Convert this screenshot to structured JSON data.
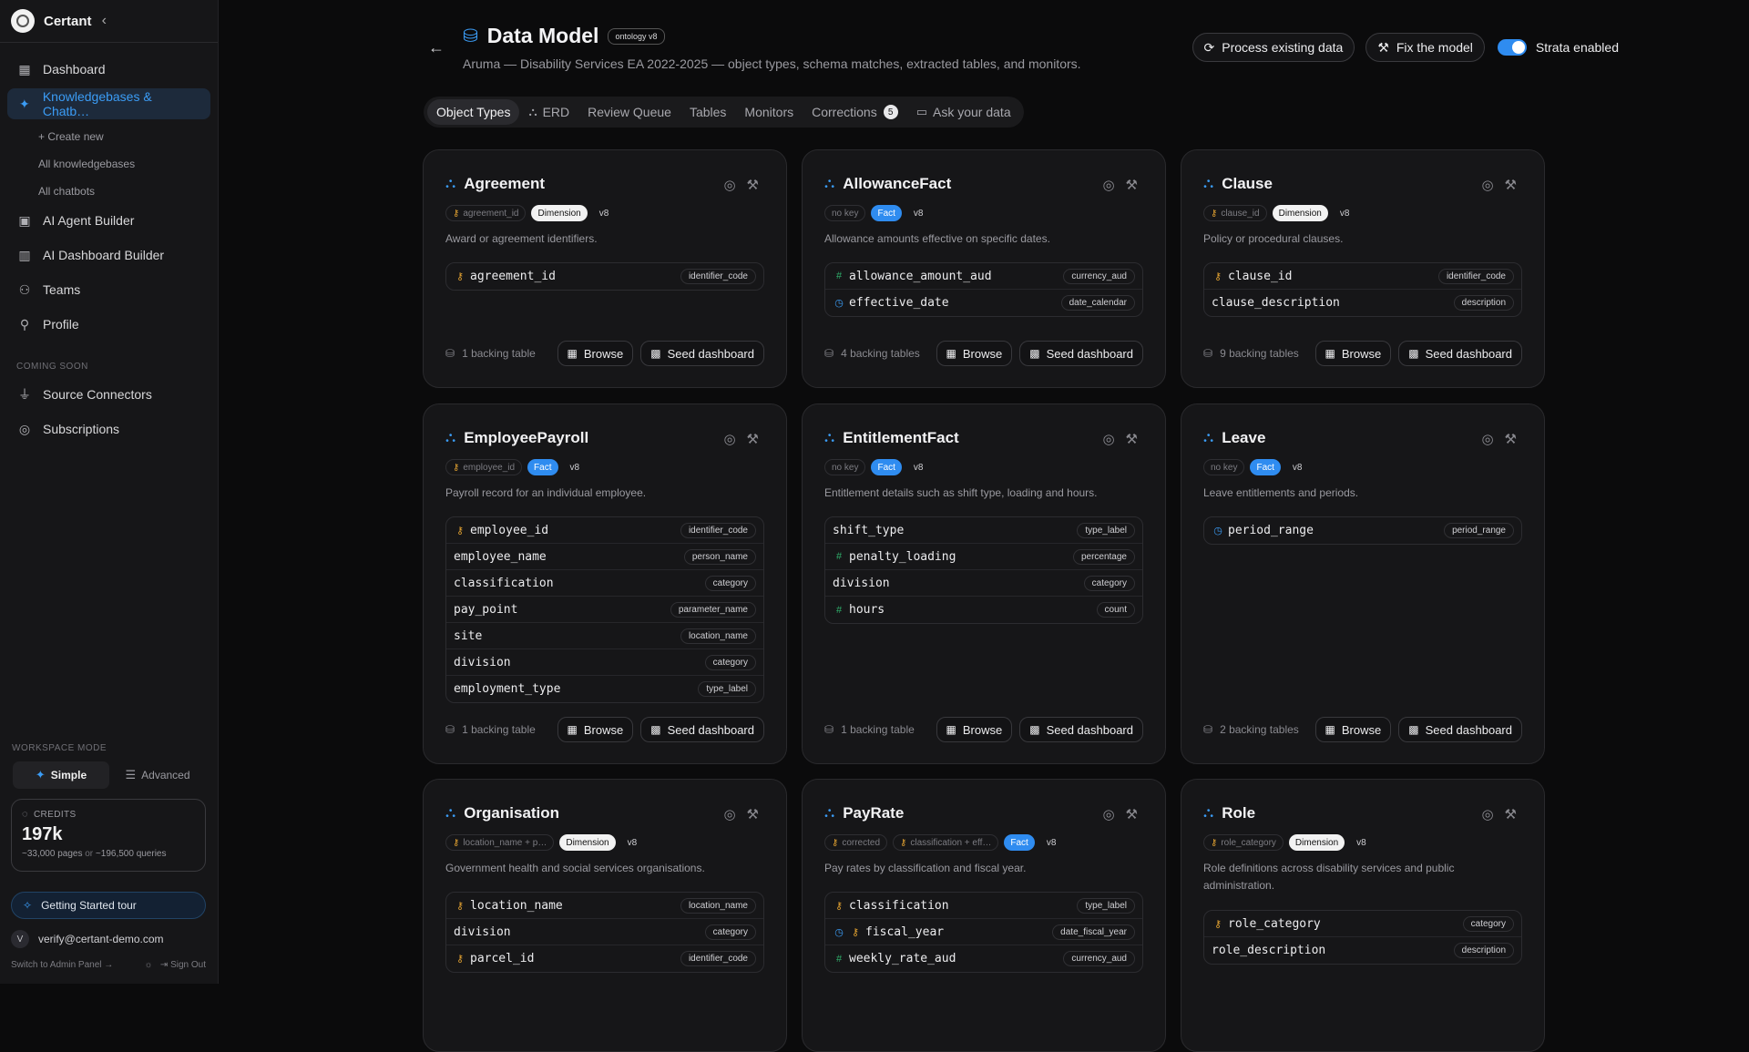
{
  "sidebar": {
    "brand": "Certant",
    "nav": [
      {
        "label": "Dashboard",
        "icon": "grid-icon"
      },
      {
        "label": "Knowledgebases & Chatb…",
        "icon": "sparkle-icon"
      }
    ],
    "subnav": [
      "+ Create new",
      "All knowledgebases",
      "All chatbots"
    ],
    "nav2": [
      {
        "label": "AI Agent Builder",
        "icon": "robot-icon"
      },
      {
        "label": "AI Dashboard Builder",
        "icon": "bar-chart-icon"
      },
      {
        "label": "Teams",
        "icon": "users-icon"
      },
      {
        "label": "Profile",
        "icon": "user-icon"
      }
    ],
    "coming_soon_label": "COMING SOON",
    "coming": [
      {
        "label": "Source Connectors",
        "icon": "plug-icon"
      },
      {
        "label": "Subscriptions",
        "icon": "broadcast-icon"
      }
    ],
    "workspace_mode_label": "WORKSPACE MODE",
    "mode_simple": "Simple",
    "mode_advanced": "Advanced",
    "credits_label": "CREDITS",
    "credits_value": "197k",
    "credits_sub_a": "~33,000 pages",
    "credits_sub_or": "or",
    "credits_sub_b": "~196,500 queries",
    "tour": "Getting Started tour",
    "user_initial": "V",
    "user_email": "verify@certant-demo.com",
    "admin_link": "Switch to Admin Panel →",
    "sign_out": "Sign Out"
  },
  "header": {
    "title": "Data Model",
    "badge": "ontology v8",
    "subtitle": "Aruma — Disability Services EA 2022-2025 — object types, schema matches, extracted tables, and monitors.",
    "process_btn": "Process existing data",
    "fix_btn": "Fix the model",
    "strata_label": "Strata enabled"
  },
  "tabs": [
    {
      "label": "Object Types",
      "active": true
    },
    {
      "label": "ERD",
      "icon": "⛬"
    },
    {
      "label": "Review Queue"
    },
    {
      "label": "Tables"
    },
    {
      "label": "Monitors"
    },
    {
      "label": "Corrections",
      "count": "5"
    },
    {
      "label": "Ask your data",
      "icon": "▭"
    }
  ],
  "cards": [
    {
      "name": "Agreement",
      "key": "agreement_id",
      "kind": "Dimension",
      "version": "v8",
      "desc": "Award or agreement identifiers.",
      "fields": [
        {
          "name": "agreement_id",
          "type": "identifier_code",
          "icon": "key"
        }
      ],
      "backing": "1 backing table"
    },
    {
      "name": "AllowanceFact",
      "key": "no key",
      "kind": "Fact",
      "version": "v8",
      "desc": "Allowance amounts effective on specific dates.",
      "fields": [
        {
          "name": "allowance_amount_aud",
          "type": "currency_aud",
          "icon": "num"
        },
        {
          "name": "effective_date",
          "type": "date_calendar",
          "icon": "time"
        }
      ],
      "backing": "4 backing tables"
    },
    {
      "name": "Clause",
      "key": "clause_id",
      "kind": "Dimension",
      "version": "v8",
      "desc": "Policy or procedural clauses.",
      "fields": [
        {
          "name": "clause_id",
          "type": "identifier_code",
          "icon": "key"
        },
        {
          "name": "clause_description",
          "type": "description",
          "icon": ""
        }
      ],
      "backing": "9 backing tables"
    },
    {
      "name": "EmployeePayroll",
      "key": "employee_id",
      "kind": "Fact",
      "version": "v8",
      "desc": "Payroll record for an individual employee.",
      "fields": [
        {
          "name": "employee_id",
          "type": "identifier_code",
          "icon": "key"
        },
        {
          "name": "employee_name",
          "type": "person_name",
          "icon": ""
        },
        {
          "name": "classification",
          "type": "category",
          "icon": ""
        },
        {
          "name": "pay_point",
          "type": "parameter_name",
          "icon": ""
        },
        {
          "name": "site",
          "type": "location_name",
          "icon": ""
        },
        {
          "name": "division",
          "type": "category",
          "icon": ""
        },
        {
          "name": "employment_type",
          "type": "type_label",
          "icon": ""
        }
      ],
      "backing": "1 backing table"
    },
    {
      "name": "EntitlementFact",
      "key": "no key",
      "kind": "Fact",
      "version": "v8",
      "desc": "Entitlement details such as shift type, loading and hours.",
      "fields": [
        {
          "name": "shift_type",
          "type": "type_label",
          "icon": ""
        },
        {
          "name": "penalty_loading",
          "type": "percentage",
          "icon": "num"
        },
        {
          "name": "division",
          "type": "category",
          "icon": ""
        },
        {
          "name": "hours",
          "type": "count",
          "icon": "num"
        }
      ],
      "backing": "1 backing table"
    },
    {
      "name": "Leave",
      "key": "no key",
      "kind": "Fact",
      "version": "v8",
      "desc": "Leave entitlements and periods.",
      "fields": [
        {
          "name": "period_range",
          "type": "period_range",
          "icon": "time"
        }
      ],
      "backing": "2 backing tables"
    },
    {
      "name": "Organisation",
      "key": "location_name + p…",
      "kind": "Dimension",
      "version": "v8",
      "desc": "Government health and social services organisations.",
      "fields": [
        {
          "name": "location_name",
          "type": "location_name",
          "icon": "key"
        },
        {
          "name": "division",
          "type": "category",
          "icon": ""
        },
        {
          "name": "parcel_id",
          "type": "identifier_code",
          "icon": "key"
        }
      ],
      "backing": ""
    },
    {
      "name": "PayRate",
      "key": "corrected",
      "key2": "classification + eff…",
      "kind": "Fact",
      "version": "v8",
      "desc": "Pay rates by classification and fiscal year.",
      "fields": [
        {
          "name": "classification",
          "type": "type_label",
          "icon": "key"
        },
        {
          "name": "fiscal_year",
          "type": "date_fiscal_year",
          "icon": "timekey"
        },
        {
          "name": "weekly_rate_aud",
          "type": "currency_aud",
          "icon": "num"
        }
      ],
      "backing": ""
    },
    {
      "name": "Role",
      "key": "role_category",
      "kind": "Dimension",
      "version": "v8",
      "desc": "Role definitions across disability services and public administration.",
      "fields": [
        {
          "name": "role_category",
          "type": "category",
          "icon": "key"
        },
        {
          "name": "role_description",
          "type": "description",
          "icon": ""
        }
      ],
      "backing": ""
    }
  ],
  "labels": {
    "browse": "Browse",
    "seed": "Seed dashboard"
  },
  "colors": {
    "accent": "#3b9cf5",
    "fact": "#2f8cf0",
    "key": "#e0a030",
    "numeric": "#2fae6a"
  }
}
